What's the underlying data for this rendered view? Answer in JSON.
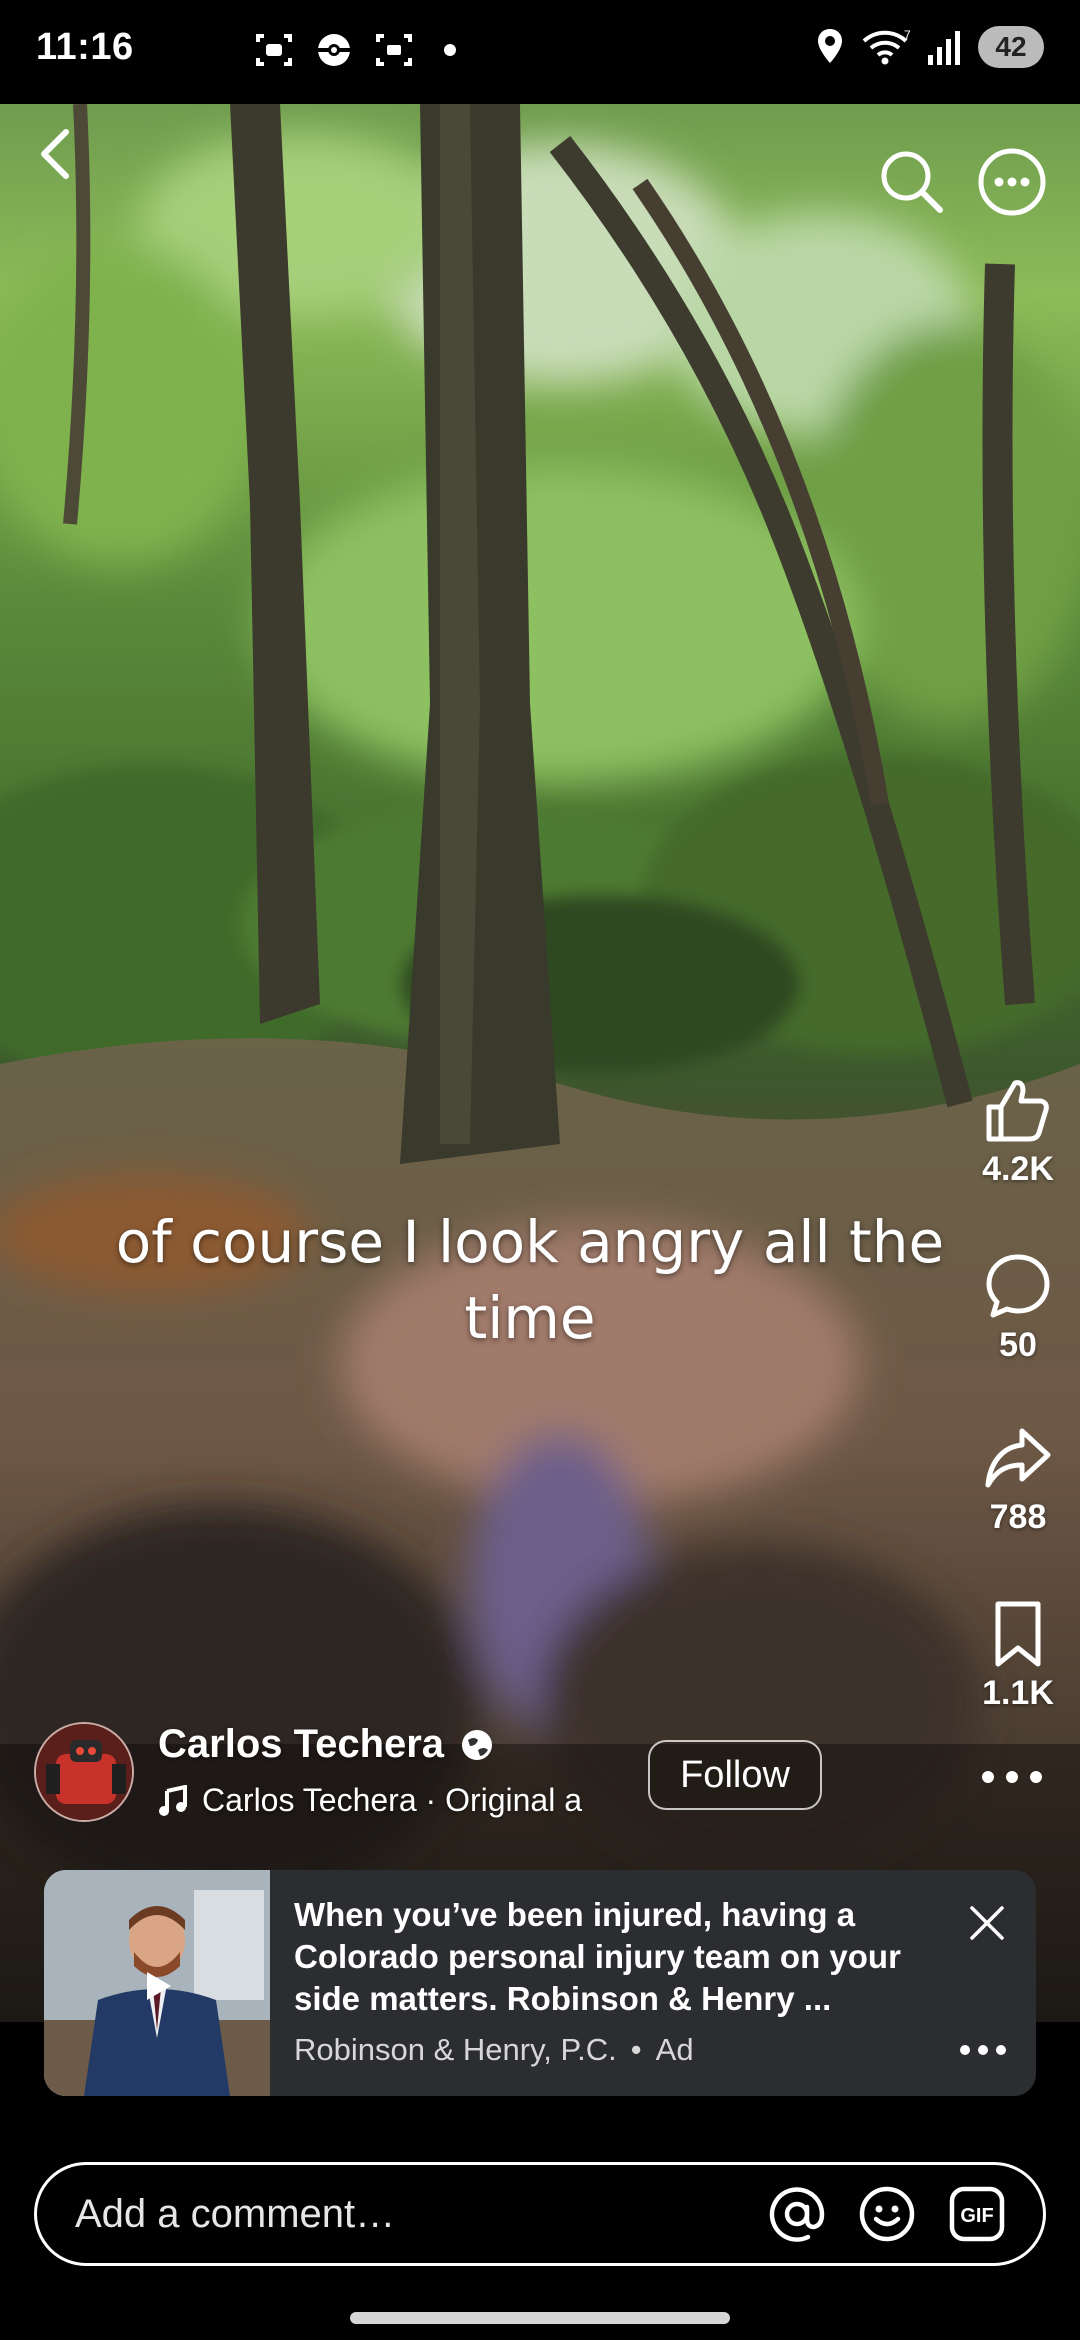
{
  "status_bar": {
    "time": "11:16",
    "battery": "42",
    "signal_label": "7"
  },
  "top_bar": {
    "back_icon": "chevron-left-icon",
    "search_icon": "search-icon",
    "more_icon": "more-circle-icon"
  },
  "video": {
    "caption": "of course I look angry all the time"
  },
  "actions": {
    "likes": "4.2K",
    "comments": "50",
    "shares": "788",
    "saves": "1.1K"
  },
  "author": {
    "name": "Carlos Techera",
    "audio": "Carlos Techera · Original a",
    "follow_label": "Follow"
  },
  "ad": {
    "text": "When you’ve been injured, having a Colorado personal injury team on your side matters. Robinson & Henry ...",
    "sponsor": "Robinson & Henry, P.C.",
    "sponsor_separator": "•",
    "ad_label": "Ad"
  },
  "comment_bar": {
    "placeholder": "Add a comment…",
    "gif_label": "GIF"
  },
  "colors": {
    "background": "#000000",
    "ad_card": "#2b2d31",
    "text": "#ffffff"
  }
}
